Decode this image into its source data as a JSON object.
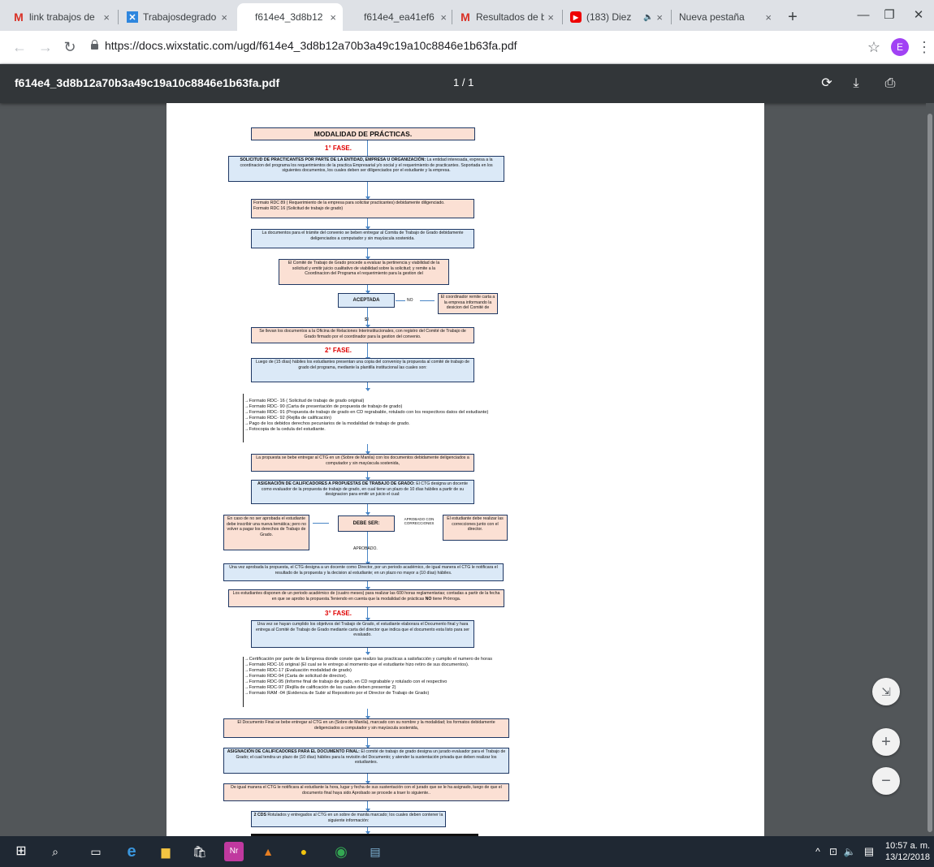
{
  "browser": {
    "tabs": [
      {
        "title": "link trabajos de",
        "icon": "gmail-icon",
        "close": "×"
      },
      {
        "title": "Trabajosdegrado",
        "icon": "wix-icon",
        "close": "×"
      },
      {
        "title": "f614e4_3d8b12",
        "icon": "pdf-icon",
        "close": "×",
        "active": true
      },
      {
        "title": "f614e4_ea41ef6",
        "icon": "pdf-icon",
        "close": "×"
      },
      {
        "title": "Resultados de b",
        "icon": "gmail-icon",
        "close": "×"
      },
      {
        "title": "(183) Diez",
        "icon": "youtube-icon",
        "close": "×"
      },
      {
        "title": "Nueva pestaña",
        "icon": "",
        "close": "×"
      }
    ],
    "url": "https://docs.wixstatic.com/ugd/f614e4_3d8b12a70b3a49c19a10c8846e1b63fa.pdf",
    "profile_initial": "E"
  },
  "pdf_viewer": {
    "filename": "f614e4_3d8b12a70b3a49c19a10c8846e1b63fa.pdf",
    "page_indicator": "1 / 1"
  },
  "document": {
    "title": "MODALIDAD DE PRÁCTICAS.",
    "fase1": "1° FASE.",
    "fase2": "2° FASE.",
    "fase3": "3° FASE.",
    "b1_bold": "SOLICITUD DE PRACTICANTES POR PARTE DE LA ENTIDAD, EMPRESA U ORGANIZACIÓN:",
    "b1_text": " La entidad interesada, expresa a la coordinacion del programa los requerimientos de la practica Empresarial y/o social y el requerimiento de practicantes. Soportada en los siguientes documentos, los cuales deben ser diligenciados por el estudiante y la empresa.",
    "b2_l1": "Formato RDC 89 ( Requerimiento de la empresa para solicitar practicantes) debidamente diligenciado.",
    "b2_l2": "Formato RDC 16 (Solicitud de trabajo de grado)",
    "b3": "La documentos para el trámite del convenio se beben entregar al Comita de Trabajo de Grado debidamente deligenciados a computador y sin mayúscula sostenida.",
    "b4": "El Comité de Trabajo de Grado procede a evaluar la pertinencia y viabilidad de la solicitud y emitir juicio cualitativo de viabilidad sobre la solicitud; y remite a la Coordinacion del Programa el requerimiento para la gestion del",
    "aceptada": "ACEPTADA",
    "no": "NO",
    "si": "SI",
    "b5": "El coordinador remite carta a la empresa informando la desicion del Comité de",
    "b6": "Se llevan los documentos a la Oficina de Relaciones Interinstitucionales, con registro del Comité de Trabajo de Grado firmado por el coordinador para la gestion del convenio.",
    "b7": "Luego de (15 días) hábiles los estudiantes presentan una copia del convenioy la propuesta al comité de trabajo de grado del programa, mediante la plantilla institucional las cuales son:",
    "list1": [
      "Formato RDC- 16 ( Solicitud de trabajo de grado original)",
      "Formato RDC- 90 (Carta de presentación de propuesta de trabajo de grado)",
      "Formato RDC- 91 (Propuesta de trabajo de grado en CD regrabable, rotulado con los respectivos datos del estudiante)",
      "Formato RDC- 92 (Rejilla de calificación)",
      "Pago de los debidos derechos pecuniarios de la modalidad de trabajo de grado.",
      "Fotocopia de la cedula del estudiante."
    ],
    "b8": "La propuesta se bebe entregar al CTG en un (Sobre de Manila) con los documentos debidamente deligenciados a computador y sin mayúscula sostenida,",
    "b9_bold": "ASIGNACIÓN DE CALIFICADORES A PROPUESTAS DE TRABAJO DE GRADO:",
    "b9_text": " El CTG designa un docente como evaluador de la propuesta de trabajo de grado, en cual tiene un plazo de 10 días hábiles a partir de su designacion para emitir un juicio el cual:",
    "b10": "En caso de no ser aprobada el estudiante debe inscribir una nueva temática; pero no volver a pagar los derechos de Trabajo de Grado.",
    "debe_ser": "DEBE SER:",
    "aprobado_corr": "APROBADO CON CORRECCIONES",
    "aprobado": "APROBADO.",
    "b11": "El estudiante debe realizar las correcciones junto con el director.",
    "b12": "Una vez aprobada la propuesta, el CTG designa a un docente como Director, por un periodo académico, de igual manera el CTG le notificara el resultado de la propuesta y la decision al estudiante; en un plazo no mayor a (10 días) hábiles.",
    "b13_a": "Los estudiantes disponen de un periodo académico de (cuatro meses) para realizar las 600 horas reglamentarias; contadas a partir de la fecha en que se aprobo la propuesta.Teniendo en cuenta que la modalidad de prácticas ",
    "b13_bold": "NO",
    "b13_b": " tiene Prórroga.",
    "b14": "Una vez se hayan cumplido los objetivos del Trabajo de Grado, el estudiante elaborara el Documento final y hara entrega al Comité de Trabajo de Grado mediante carta del director que indica que el documento esta listo para ser evaluado.",
    "list2": [
      "Certificación por parte de la Empresa donde conste que realizo las practicas a satisfacción y cumplio el numero de horas",
      "Formato RDC-16 original (El cual se le entrego al momento que el estudiante hizo retiro de sus documentos).",
      "Formato RDC-17 (Evaluación modalidad de grado)",
      "Formato RDC-94 (Carta de solicitud de director).",
      "Formato RDC-95 (Informe final de trabajo de grado, en CD regrabable y rotulado con el respectivo",
      "Formato RDC-97 (Rejilla de calificación de las cuales deben presentar 2)",
      "Formato RAM -04 (Evidencia de Subir al Repositorio por el Director de Trabajo de Grado)"
    ],
    "b15": "El Documento Final se bebe entregar al CTG en un (Sobre de Manila), marcado con su nombre y la modalidad; los formatos debidamente deligenciados a computador y sin mayúscula sostenida,",
    "b16_bold": "ASIGNACIÓN DE CALIFICADORES PARA EL DOCUMENTO FINAL:",
    "b16_text": " El comité de trabajo de grado designa un jurado evaluador para el Trabajo de Grado; el cual tendra un plazo de (10 días) hábiles para la revisión del Documento; y atender la sustentación privada que deben realizar los estudiantes.",
    "b17": "De igual manera el CTG le notificara al estudiante la hora, lugar y fecha de sus sustentación con el jurado que se le ha asignado, luego de que el documento final haya sido Aprobado se procede a traer lo siguiente..",
    "b18_bold": "2 CDS",
    "b18_text": " Rotulados y entregados al CTG en un sobre de manila marcado; los cuales deben contener la siguiente información:"
  },
  "zoom_controls": {
    "fit": "⇲",
    "plus": "+",
    "minus": "−"
  },
  "taskbar": {
    "time": "10:57 a. m.",
    "date": "13/12/2018"
  }
}
